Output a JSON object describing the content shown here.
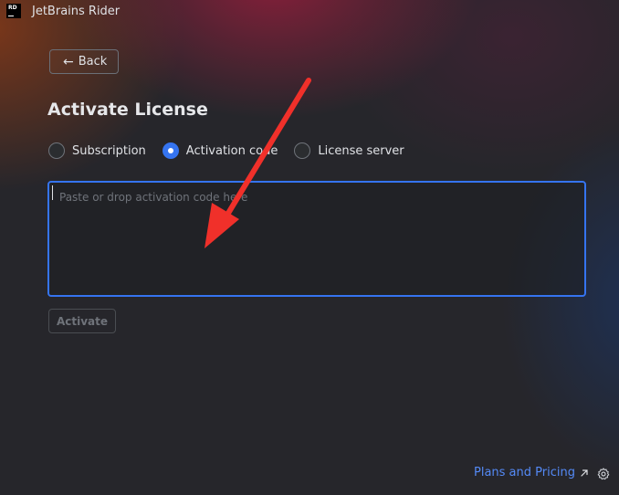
{
  "titlebar": {
    "logo_text": "RD",
    "app_name": "JetBrains Rider"
  },
  "back_button": {
    "icon": "arrow-left-icon",
    "label": "Back"
  },
  "page": {
    "heading": "Activate License"
  },
  "license_options": {
    "selected": "Activation code",
    "items": [
      {
        "label": "Subscription",
        "selected": false
      },
      {
        "label": "Activation code",
        "selected": true
      },
      {
        "label": "License server",
        "selected": false
      }
    ]
  },
  "activation_code": {
    "value": "",
    "placeholder": "Paste or drop activation code here"
  },
  "activate_button": {
    "label": "Activate",
    "enabled": false
  },
  "footer": {
    "plans_link": "Plans and Pricing",
    "plans_link_icon": "external-link-icon",
    "settings_icon": "gear-icon"
  },
  "colors": {
    "accent": "#3574f0",
    "link": "#548af7",
    "annotation_arrow": "#f0302a",
    "background": "#26262b"
  }
}
